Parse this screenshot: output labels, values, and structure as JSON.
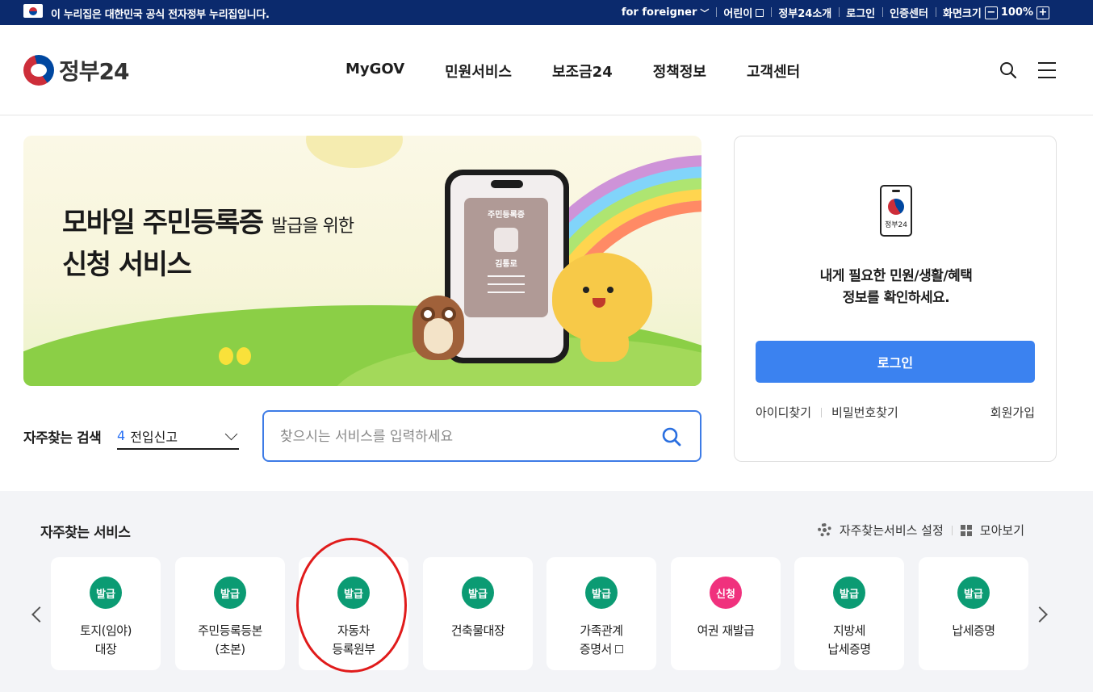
{
  "topbar": {
    "notice": "이 누리집은 대한민국 공식 전자정부 누리집입니다.",
    "foreigner": "for foreigner",
    "kids": "어린이",
    "about": "정부24소개",
    "login": "로그인",
    "cert": "인증센터",
    "zoom_label": "화면크기",
    "zoom_value": "100%",
    "zoom_minus": "−",
    "zoom_plus": "+"
  },
  "header": {
    "logo_text": "정부24",
    "nav": [
      "MyGOV",
      "민원서비스",
      "보조금24",
      "정책정보",
      "고객센터"
    ]
  },
  "banner": {
    "title_bold": "모바일 주민등록증",
    "title_small": "발급을 위한",
    "title_line2": "신청 서비스",
    "card_title": "주민등록증",
    "card_name": "김통로"
  },
  "search": {
    "fav_label": "자주찾는 검색",
    "fav_index": "4",
    "fav_value": "전입신고",
    "placeholder": "찾으시는 서비스를 입력하세요"
  },
  "login_card": {
    "device_label": "정부24",
    "message_line1": "내게 필요한 민원/생활/혜택",
    "message_line2": "정보를 확인하세요.",
    "login_button": "로그인",
    "find_id": "아이디찾기",
    "find_pw": "비밀번호찾기",
    "join": "회원가입"
  },
  "services": {
    "title": "자주찾는 서비스",
    "settings": "자주찾는서비스 설정",
    "view_all": "모아보기",
    "items": [
      {
        "badge": "발급",
        "line1": "토지(임야)",
        "line2": "대장",
        "color": "#0b9b73"
      },
      {
        "badge": "발급",
        "line1": "주민등록등본",
        "line2": "(초본)",
        "color": "#0b9b73"
      },
      {
        "badge": "발급",
        "line1": "자동차",
        "line2": "등록원부",
        "color": "#0b9b73"
      },
      {
        "badge": "발급",
        "line1": "건축물대장",
        "line2": "",
        "color": "#0b9b73"
      },
      {
        "badge": "발급",
        "line1": "가족관계",
        "line2": "증명서",
        "color": "#0b9b73"
      },
      {
        "badge": "신청",
        "line1": "여권 재발급",
        "line2": "",
        "color": "#f0317d"
      },
      {
        "badge": "발급",
        "line1": "지방세",
        "line2": "납세증명",
        "color": "#0b9b73"
      },
      {
        "badge": "발급",
        "line1": "납세증명",
        "line2": "",
        "color": "#0b9b73"
      }
    ]
  }
}
